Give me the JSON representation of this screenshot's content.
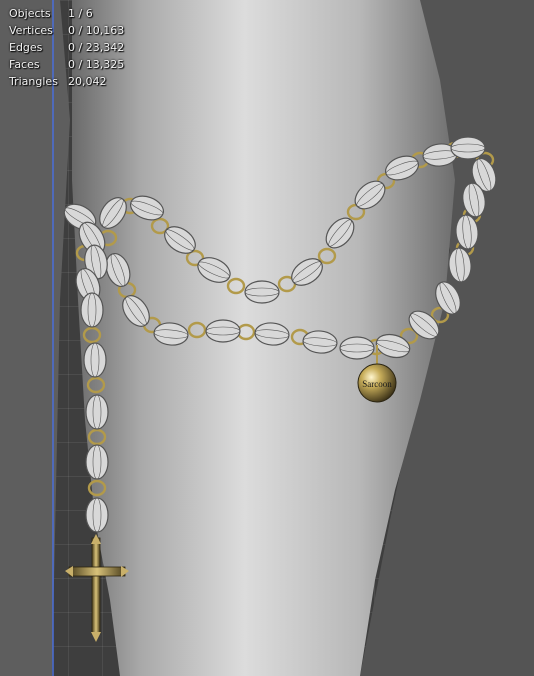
{
  "viewport": {
    "stats": [
      {
        "label": "Objects",
        "value": "1 / 6"
      },
      {
        "label": "Vertices",
        "value": "0 / 10,163"
      },
      {
        "label": "Edges",
        "value": "0 / 23,342"
      },
      {
        "label": "Faces",
        "value": "0 / 13,325"
      },
      {
        "label": "Triangles",
        "value": "20,042"
      }
    ]
  },
  "scene": {
    "medallion_text": "Sarcoon",
    "colors": {
      "background": "#3e3e3e",
      "axis_line": "#4a6fd8",
      "body_mesh": "#bdbdbd",
      "bead": "#d8d8d8",
      "bead_wire": "#555555",
      "metal": "#b29a4a"
    }
  }
}
